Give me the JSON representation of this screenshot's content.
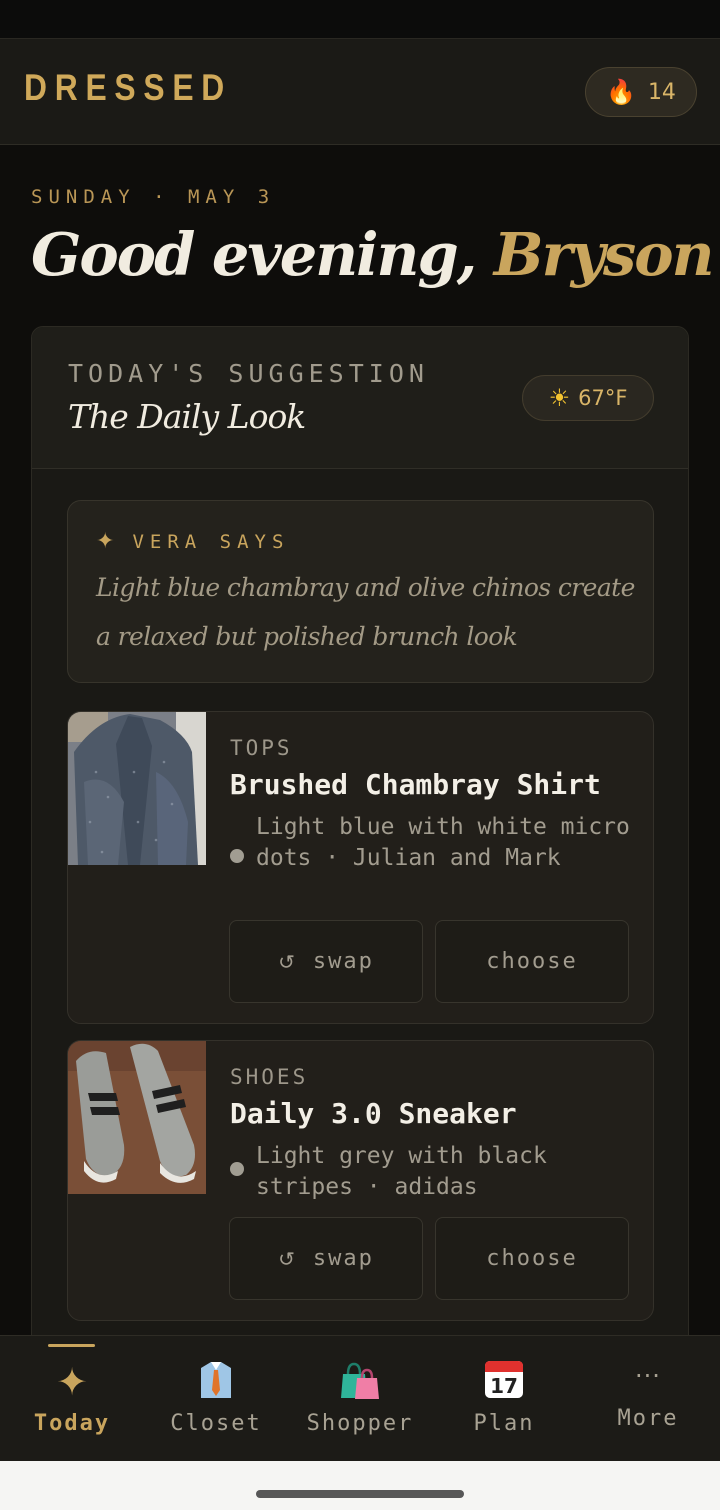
{
  "header": {
    "brand": "DRESSED",
    "streak_icon": "flame-icon",
    "streak_count": "14"
  },
  "greeting": {
    "date": "SUNDAY · MAY 3",
    "salutation": "Good evening,",
    "name": "Bryson"
  },
  "suggestion": {
    "eyebrow": "TODAY'S SUGGESTION",
    "title": "The Daily Look",
    "weather_icon": "sun-icon",
    "temperature": "67°F",
    "vera": {
      "label": "VERA SAYS",
      "quote": "Light blue chambray and olive chinos create a relaxed but polished brunch look"
    },
    "items": [
      {
        "category": "TOPS",
        "name": "Brushed Chambray Shirt",
        "description": "Light blue with white micro dots · Julian and Mark",
        "swap_label": "swap",
        "choose_label": "choose"
      },
      {
        "category": "SHOES",
        "name": "Daily 3.0 Sneaker",
        "description": "Light grey with black stripes · adidas",
        "swap_label": "swap",
        "choose_label": "choose"
      }
    ]
  },
  "nav": {
    "tabs": [
      {
        "label": "Today",
        "icon": "sparkle-icon",
        "active": true
      },
      {
        "label": "Closet",
        "icon": "shirt-tie-icon",
        "active": false
      },
      {
        "label": "Shopper",
        "icon": "shopping-bags-icon",
        "active": false
      },
      {
        "label": "Plan",
        "icon": "calendar-icon",
        "active": false
      },
      {
        "label": "More",
        "icon": "ellipsis-icon",
        "active": false
      }
    ]
  },
  "colors": {
    "accent": "#c9a55d",
    "background": "#0e0d0b",
    "card": "#1a1915"
  }
}
